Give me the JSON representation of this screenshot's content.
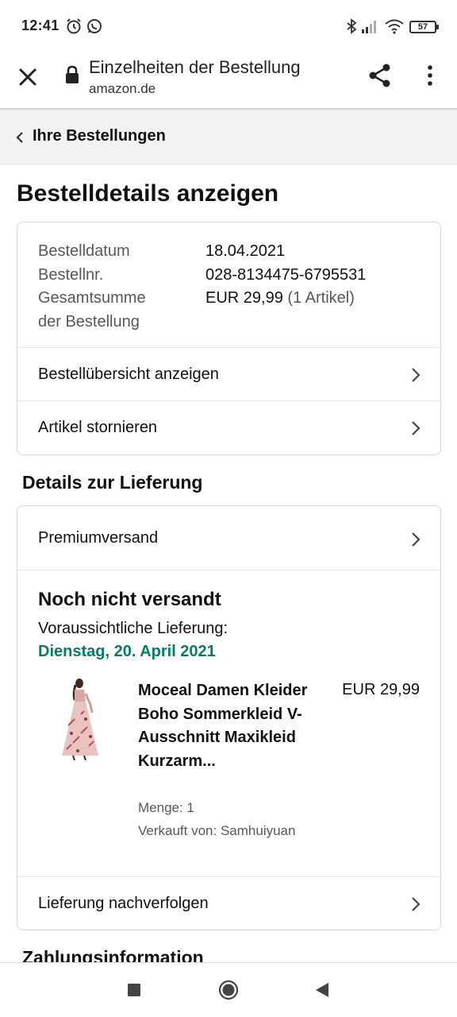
{
  "status_bar": {
    "time": "12:41",
    "battery": "57"
  },
  "browser": {
    "title": "Einzelheiten der Bestellung",
    "url": "amazon.de"
  },
  "breadcrumb": {
    "label": "Ihre Bestellungen"
  },
  "page_title": "Bestelldetails anzeigen",
  "order_info": {
    "date_label": "Bestelldatum",
    "date_value": "18.04.2021",
    "number_label": "Bestellnr.",
    "number_value": "028-8134475-6795531",
    "total_label_line1": "Gesamtsumme",
    "total_label_line2": "der Bestellung",
    "total_value": "EUR 29,99",
    "total_items": "(1 Artikel)"
  },
  "order_links": {
    "summary": "Bestellübersicht anzeigen",
    "cancel": "Artikel stornieren"
  },
  "delivery": {
    "heading": "Details zur Lieferung",
    "shipping_method": "Premiumversand",
    "status": "Noch nicht versandt",
    "eta_label": "Voraussichtliche Lieferung:",
    "eta_date": "Dienstag, 20. April 2021",
    "eta_color": "#067d62",
    "product": {
      "title": "Moceal Damen Kleider Boho Sommerkleid V-Ausschnitt Maxikleid Kurzarm...",
      "price": "EUR 29,99",
      "quantity": "Menge: 1",
      "seller": "Verkauft von: Samhuiyuan"
    },
    "track": "Lieferung nachverfolgen"
  },
  "next_heading": "Zahlungsinformation"
}
